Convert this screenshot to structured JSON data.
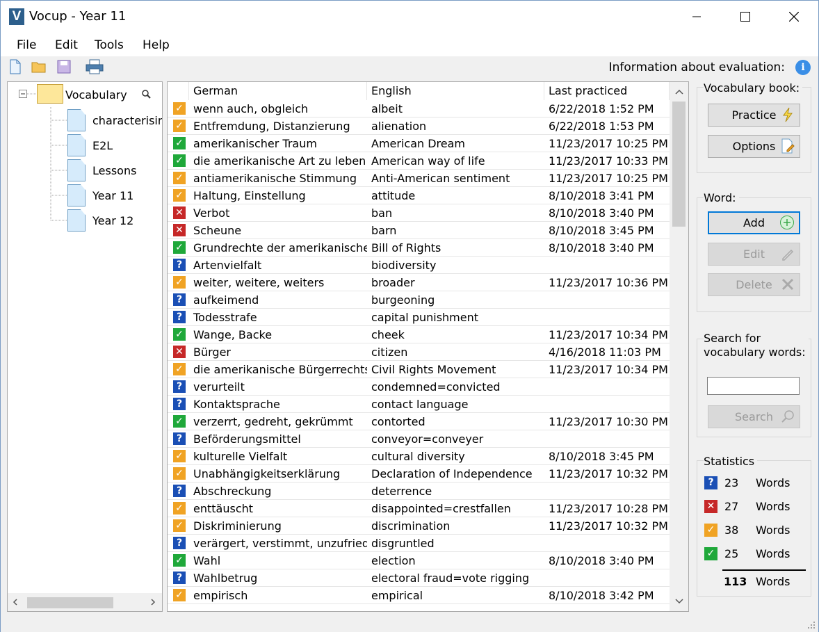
{
  "window": {
    "title": "Vocup - Year 11",
    "app_letter": "V"
  },
  "menu": [
    {
      "label": "File"
    },
    {
      "label": "Edit"
    },
    {
      "label": "Tools"
    },
    {
      "label": "Help"
    }
  ],
  "toolbar": {
    "eval_info": "Information about evaluation:",
    "info_glyph": "i"
  },
  "tree": {
    "root": "Vocabulary",
    "children": [
      {
        "label": "characterising"
      },
      {
        "label": "E2L"
      },
      {
        "label": "Lessons"
      },
      {
        "label": "Year 11"
      },
      {
        "label": "Year 12"
      }
    ]
  },
  "table": {
    "headers": {
      "german": "German",
      "english": "English",
      "last": "Last practiced"
    },
    "rows": [
      {
        "status": "partial",
        "german": "wenn auch, obgleich",
        "english": "albeit",
        "last": "6/22/2018 1:52 PM"
      },
      {
        "status": "partial",
        "german": "Entfremdung, Distanzierung",
        "english": "alienation",
        "last": "6/22/2018 1:53 PM"
      },
      {
        "status": "correct",
        "german": "amerikanischer Traum",
        "english": "American Dream",
        "last": "11/23/2017 10:25 PM"
      },
      {
        "status": "correct",
        "german": "die amerikanische Art zu leben",
        "english": "American way of life",
        "last": "11/23/2017 10:33 PM"
      },
      {
        "status": "partial",
        "german": "antiamerikanische Stimmung",
        "english": "Anti-American sentiment",
        "last": "11/23/2017 10:25 PM"
      },
      {
        "status": "partial",
        "german": "Haltung, Einstellung",
        "english": "attitude",
        "last": "8/10/2018 3:41 PM"
      },
      {
        "status": "wrong",
        "german": "Verbot",
        "english": "ban",
        "last": "8/10/2018 3:40 PM"
      },
      {
        "status": "wrong",
        "german": "Scheune",
        "english": "barn",
        "last": "8/10/2018 3:45 PM"
      },
      {
        "status": "correct",
        "german": "Grundrechte der amerikanische...",
        "english": "Bill of Rights",
        "last": "8/10/2018 3:40 PM"
      },
      {
        "status": "unpracticed",
        "german": "Artenvielfalt",
        "english": "biodiversity",
        "last": ""
      },
      {
        "status": "partial",
        "german": "weiter, weitere, weiters",
        "english": "broader",
        "last": "11/23/2017 10:36 PM"
      },
      {
        "status": "unpracticed",
        "german": "aufkeimend",
        "english": "burgeoning",
        "last": ""
      },
      {
        "status": "unpracticed",
        "german": "Todesstrafe",
        "english": "capital punishment",
        "last": ""
      },
      {
        "status": "correct",
        "german": "Wange, Backe",
        "english": "cheek",
        "last": "11/23/2017 10:34 PM"
      },
      {
        "status": "wrong",
        "german": "Bürger",
        "english": "citizen",
        "last": "4/16/2018 11:03 PM"
      },
      {
        "status": "partial",
        "german": "die amerikanische Bürgerrechts...",
        "english": "Civil Rights Movement",
        "last": "11/23/2017 10:34 PM"
      },
      {
        "status": "unpracticed",
        "german": "verurteilt",
        "english": "condemned=convicted",
        "last": ""
      },
      {
        "status": "unpracticed",
        "german": "Kontaktsprache",
        "english": "contact language",
        "last": ""
      },
      {
        "status": "correct",
        "german": "verzerrt, gedreht, gekrümmt",
        "english": "contorted",
        "last": "11/23/2017 10:30 PM"
      },
      {
        "status": "unpracticed",
        "german": "Beförderungsmittel",
        "english": "conveyor=conveyer",
        "last": ""
      },
      {
        "status": "partial",
        "german": "kulturelle Vielfalt",
        "english": "cultural diversity",
        "last": "8/10/2018 3:45 PM"
      },
      {
        "status": "partial",
        "german": "Unabhängigkeitserklärung",
        "english": "Declaration of Independence",
        "last": "11/23/2017 10:32 PM"
      },
      {
        "status": "unpracticed",
        "german": "Abschreckung",
        "english": "deterrence",
        "last": ""
      },
      {
        "status": "partial",
        "german": "enttäuscht",
        "english": "disappointed=crestfallen",
        "last": "11/23/2017 10:28 PM"
      },
      {
        "status": "partial",
        "german": "Diskriminierung",
        "english": "discrimination",
        "last": "11/23/2017 10:32 PM"
      },
      {
        "status": "unpracticed",
        "german": "verärgert, verstimmt, unzufrieden",
        "english": "disgruntled",
        "last": ""
      },
      {
        "status": "correct",
        "german": "Wahl",
        "english": "election",
        "last": "8/10/2018 3:40 PM"
      },
      {
        "status": "unpracticed",
        "german": "Wahlbetrug",
        "english": "electoral fraud=vote rigging",
        "last": ""
      },
      {
        "status": "partial",
        "german": "empirisch",
        "english": "empirical",
        "last": "8/10/2018 3:42 PM"
      }
    ]
  },
  "status_styles": {
    "correct": {
      "color": "#1fa83a",
      "glyph": "✓"
    },
    "wrong": {
      "color": "#c62828",
      "glyph": "✕"
    },
    "partial": {
      "color": "#f0a324",
      "glyph": "✓"
    },
    "unpracticed": {
      "color": "#1a4fb5",
      "glyph": "?"
    }
  },
  "side": {
    "book_group": "Vocabulary book:",
    "practice": "Practice",
    "options": "Options",
    "word_group": "Word:",
    "add": "Add",
    "edit": "Edit",
    "delete": "Delete",
    "search_group": "Search for\nvocabulary words:",
    "search_value": "",
    "search_btn": "Search",
    "stats_group": "Statistics",
    "stats": [
      {
        "status": "unpracticed",
        "count": "23",
        "label": "Words"
      },
      {
        "status": "wrong",
        "count": "27",
        "label": "Words"
      },
      {
        "status": "partial",
        "count": "38",
        "label": "Words"
      },
      {
        "status": "correct",
        "count": "25",
        "label": "Words"
      }
    ],
    "total": {
      "count": "113",
      "label": "Words"
    }
  }
}
